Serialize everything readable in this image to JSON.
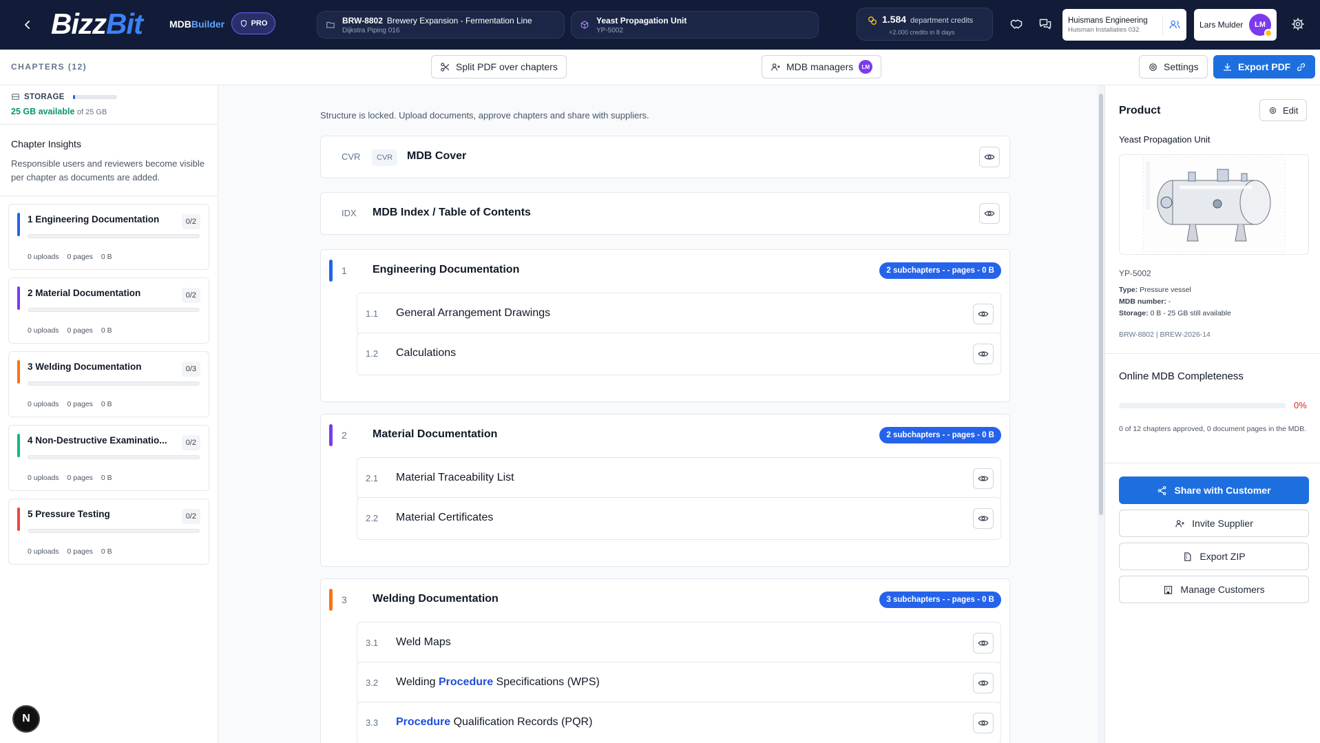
{
  "topbar": {
    "logo_part1": "Bizz",
    "logo_part2": "Bit",
    "product_part1": "MDB",
    "product_part2": "Builder",
    "pro_label": "PRO",
    "project": {
      "code": "BRW-8802",
      "name": "Brewery Expansion - Fermentation Line",
      "client": "Dijkstra Piping 016"
    },
    "unit": {
      "name": "Yeast Propagation Unit",
      "code": "YP-5002"
    },
    "credits": {
      "amount": "1.584",
      "label": "department credits",
      "sub": "+2.000 credits in 8 days"
    },
    "company": {
      "name": "Huismans Engineering",
      "sub": "Huisman Installaties 032"
    },
    "user": {
      "name": "Lars Mulder",
      "initials": "LM"
    }
  },
  "toolbar": {
    "chapters_title": "CHAPTERS (12)",
    "split_pdf": "Split PDF over chapters",
    "mdb_managers": "MDB managers",
    "managers_initials": "LM",
    "settings": "Settings",
    "export_pdf": "Export PDF"
  },
  "sidebar": {
    "storage_label": "STORAGE",
    "storage_available": "25 GB available",
    "storage_of": "of 25 GB",
    "insights_title": "Chapter Insights",
    "insights_text": "Responsible users and reviewers become visible per chapter as documents are added.",
    "chapters": [
      {
        "title": "1 Engineering Documentation",
        "count": "0/2",
        "uploads": "0 uploads",
        "pages": "0 pages",
        "size": "0 B",
        "color": "#2563eb"
      },
      {
        "title": "2 Material Documentation",
        "count": "0/2",
        "uploads": "0 uploads",
        "pages": "0 pages",
        "size": "0 B",
        "color": "#7c3aed"
      },
      {
        "title": "3 Welding Documentation",
        "count": "0/3",
        "uploads": "0 uploads",
        "pages": "0 pages",
        "size": "0 B",
        "color": "#f97316"
      },
      {
        "title": "4 Non-Destructive Examinatio...",
        "count": "0/2",
        "uploads": "0 uploads",
        "pages": "0 pages",
        "size": "0 B",
        "color": "#10b981"
      },
      {
        "title": "5 Pressure Testing",
        "count": "0/2",
        "uploads": "0 uploads",
        "pages": "0 pages",
        "size": "0 B",
        "color": "#ef4444"
      }
    ]
  },
  "main": {
    "lock_message": "Structure is locked. Upload documents, approve chapters and share with suppliers.",
    "cover": {
      "code": "CVR",
      "tag": "CVR",
      "name": "MDB Cover"
    },
    "index": {
      "code": "IDX",
      "name": "MDB Index / Table of Contents"
    },
    "sections": [
      {
        "num": "1",
        "name": "Engineering Documentation",
        "badge": "2 subchapters - - pages - 0 B",
        "color": "#2563eb",
        "subs": [
          {
            "num": "1.1",
            "pre": "General Arrangement Drawings",
            "hl": "",
            "post": ""
          },
          {
            "num": "1.2",
            "pre": "Calculations",
            "hl": "",
            "post": ""
          }
        ]
      },
      {
        "num": "2",
        "name": "Material Documentation",
        "badge": "2 subchapters - - pages - 0 B",
        "color": "#7c3aed",
        "subs": [
          {
            "num": "2.1",
            "pre": "Material Traceability List",
            "hl": "",
            "post": ""
          },
          {
            "num": "2.2",
            "pre": "Material Certificates",
            "hl": "",
            "post": ""
          }
        ]
      },
      {
        "num": "3",
        "name": "Welding Documentation",
        "badge": "3 subchapters - - pages - 0 B",
        "color": "#f97316",
        "subs": [
          {
            "num": "3.1",
            "pre": "Weld Maps",
            "hl": "",
            "post": ""
          },
          {
            "num": "3.2",
            "pre": "Welding ",
            "hl": "Procedure",
            "post": " Specifications (WPS)"
          },
          {
            "num": "3.3",
            "pre": "",
            "hl": "Procedure",
            "post": " Qualification Records (PQR)"
          }
        ]
      }
    ]
  },
  "right": {
    "product_title": "Product",
    "edit": "Edit",
    "product_name": "Yeast Propagation Unit",
    "code": "YP-5002",
    "type_label": "Type:",
    "type_value": "Pressure vessel",
    "mdb_label": "MDB number:",
    "mdb_value": "-",
    "storage_label": "Storage:",
    "storage_value": "0 B - 25 GB still available",
    "refs": "BRW-8802 | BREW-2026-14",
    "completeness_title": "Online MDB Completeness",
    "completeness_pct": "0%",
    "completeness_value": 0,
    "completeness_text": "0 of 12 chapters approved, 0 document pages in the MDB.",
    "share": "Share with Customer",
    "invite": "Invite Supplier",
    "export_zip": "Export ZIP",
    "manage": "Manage Customers"
  },
  "misc": {
    "n_label": "N"
  }
}
